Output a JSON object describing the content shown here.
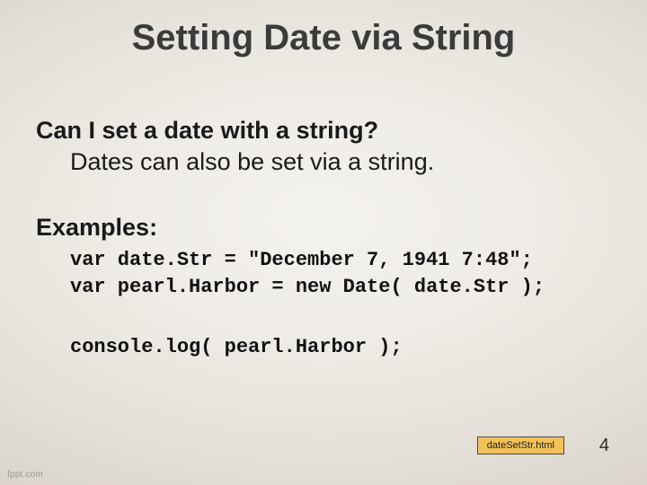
{
  "slide": {
    "title": "Setting Date via String",
    "question": "Can I set a date with a string?",
    "answer": "Dates can also be set via a string.",
    "examples_label": "Examples:",
    "code1_line1": "var date.Str = \"December 7, 1941 7:48\";",
    "code1_line2": "var pearl.Harbor = new Date( date.Str );",
    "code2_line1": "console.log( pearl.Harbor );",
    "file_badge": "dateSetStr.html",
    "page_number": "4",
    "watermark": "fppt.com"
  }
}
